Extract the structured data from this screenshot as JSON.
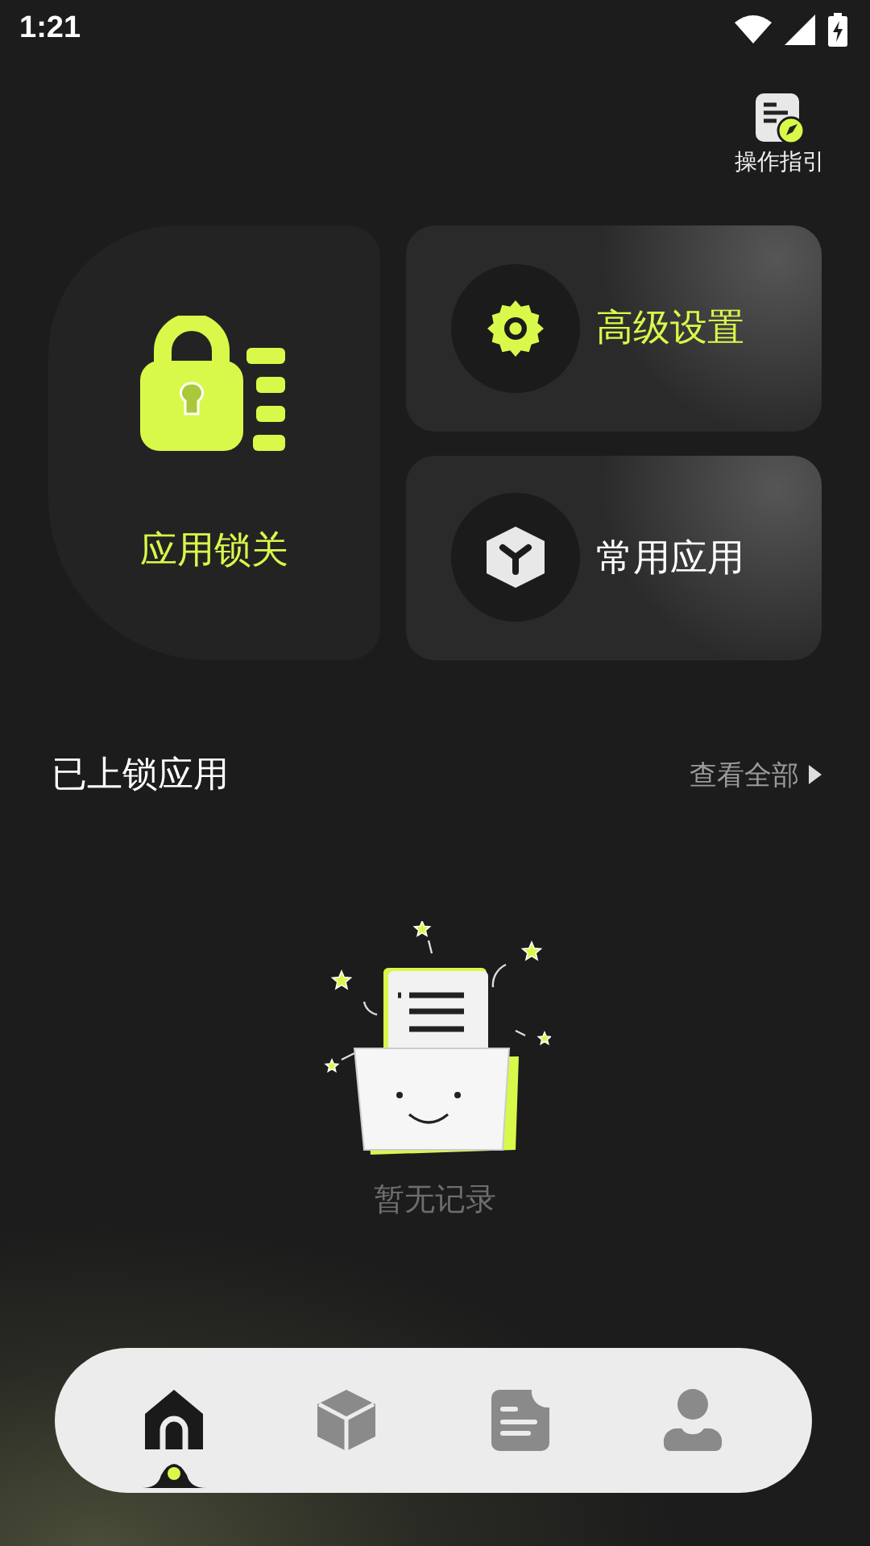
{
  "status_bar": {
    "time": "1:21"
  },
  "guide": {
    "label": "操作指引"
  },
  "cards": [
    {
      "kind": "lock",
      "label": "应用锁关"
    },
    {
      "kind": "settings",
      "label": "高级设置"
    },
    {
      "kind": "apps",
      "label": "常用应用"
    }
  ],
  "section": {
    "title": "已上锁应用",
    "link": "查看全部"
  },
  "empty": {
    "message": "暂无记录"
  },
  "nav": [
    {
      "kind": "home",
      "selected": true
    },
    {
      "kind": "box",
      "selected": false
    },
    {
      "kind": "doc",
      "selected": false
    },
    {
      "kind": "user",
      "selected": false
    }
  ]
}
